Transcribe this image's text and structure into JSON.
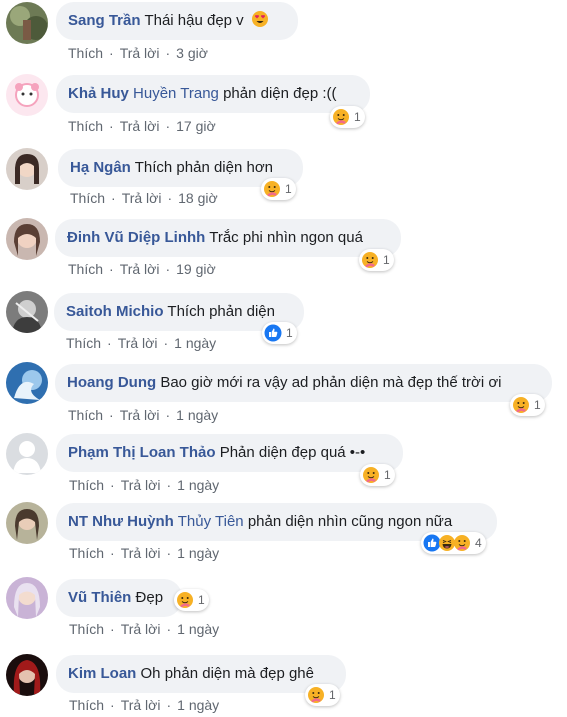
{
  "actions": {
    "like": "Thích",
    "reply": "Trả lời"
  },
  "comments": [
    {
      "author": "Sang Trần",
      "tag": "",
      "text": "Thái hậu đẹp v",
      "time": "3 giờ",
      "reaction_icons": [],
      "reaction_count": ""
    },
    {
      "author": "Khả Huy",
      "tag": "Huyền Trang",
      "text": "phản diện đẹp :((",
      "time": "17 giờ",
      "reaction_icons": [
        "care"
      ],
      "reaction_count": "1"
    },
    {
      "author": "Hạ Ngân",
      "tag": "",
      "text": "Thích phản diện hơn",
      "time": "18 giờ",
      "reaction_icons": [
        "care"
      ],
      "reaction_count": "1"
    },
    {
      "author": "Đinh Vũ Diệp Linhh",
      "tag": "",
      "text": "Trắc phi nhìn ngon quá",
      "time": "19 giờ",
      "reaction_icons": [
        "care"
      ],
      "reaction_count": "1"
    },
    {
      "author": "Saitoh Michio",
      "tag": "",
      "text": "Thích phản diện",
      "time": "1 ngày",
      "reaction_icons": [
        "like"
      ],
      "reaction_count": "1"
    },
    {
      "author": "Hoang Dung",
      "tag": "",
      "text": "Bao giờ mới ra vậy ad phản diện mà đẹp thế trời ơi",
      "time": "1 ngày",
      "reaction_icons": [
        "care"
      ],
      "reaction_count": "1"
    },
    {
      "author": "Phạm Thị Loan Thảo",
      "tag": "",
      "text": "Phản diện đẹp quá •-•",
      "time": "1 ngày",
      "reaction_icons": [
        "care"
      ],
      "reaction_count": "1"
    },
    {
      "author": "NT Như Huỳnh",
      "tag": "Thủy Tiên",
      "text": "phản diện nhìn cũng ngon nữa",
      "time": "1 ngày",
      "reaction_icons": [
        "like",
        "haha",
        "care"
      ],
      "reaction_count": "4"
    },
    {
      "author": "Vũ Thiên",
      "tag": "",
      "text": "Đẹp",
      "time": "1 ngày",
      "reaction_icons": [
        "care"
      ],
      "reaction_count": "1"
    },
    {
      "author": "Kim Loan",
      "tag": "",
      "text": "Oh phản diện mà đẹp ghê",
      "time": "1 ngày",
      "reaction_icons": [
        "care"
      ],
      "reaction_count": "1"
    }
  ],
  "colors": {
    "author": "#385898",
    "bubble": "#f0f2f5",
    "meta": "#606770",
    "like_blue": "#1877f2",
    "emoji_yellow": "#f7b125"
  }
}
